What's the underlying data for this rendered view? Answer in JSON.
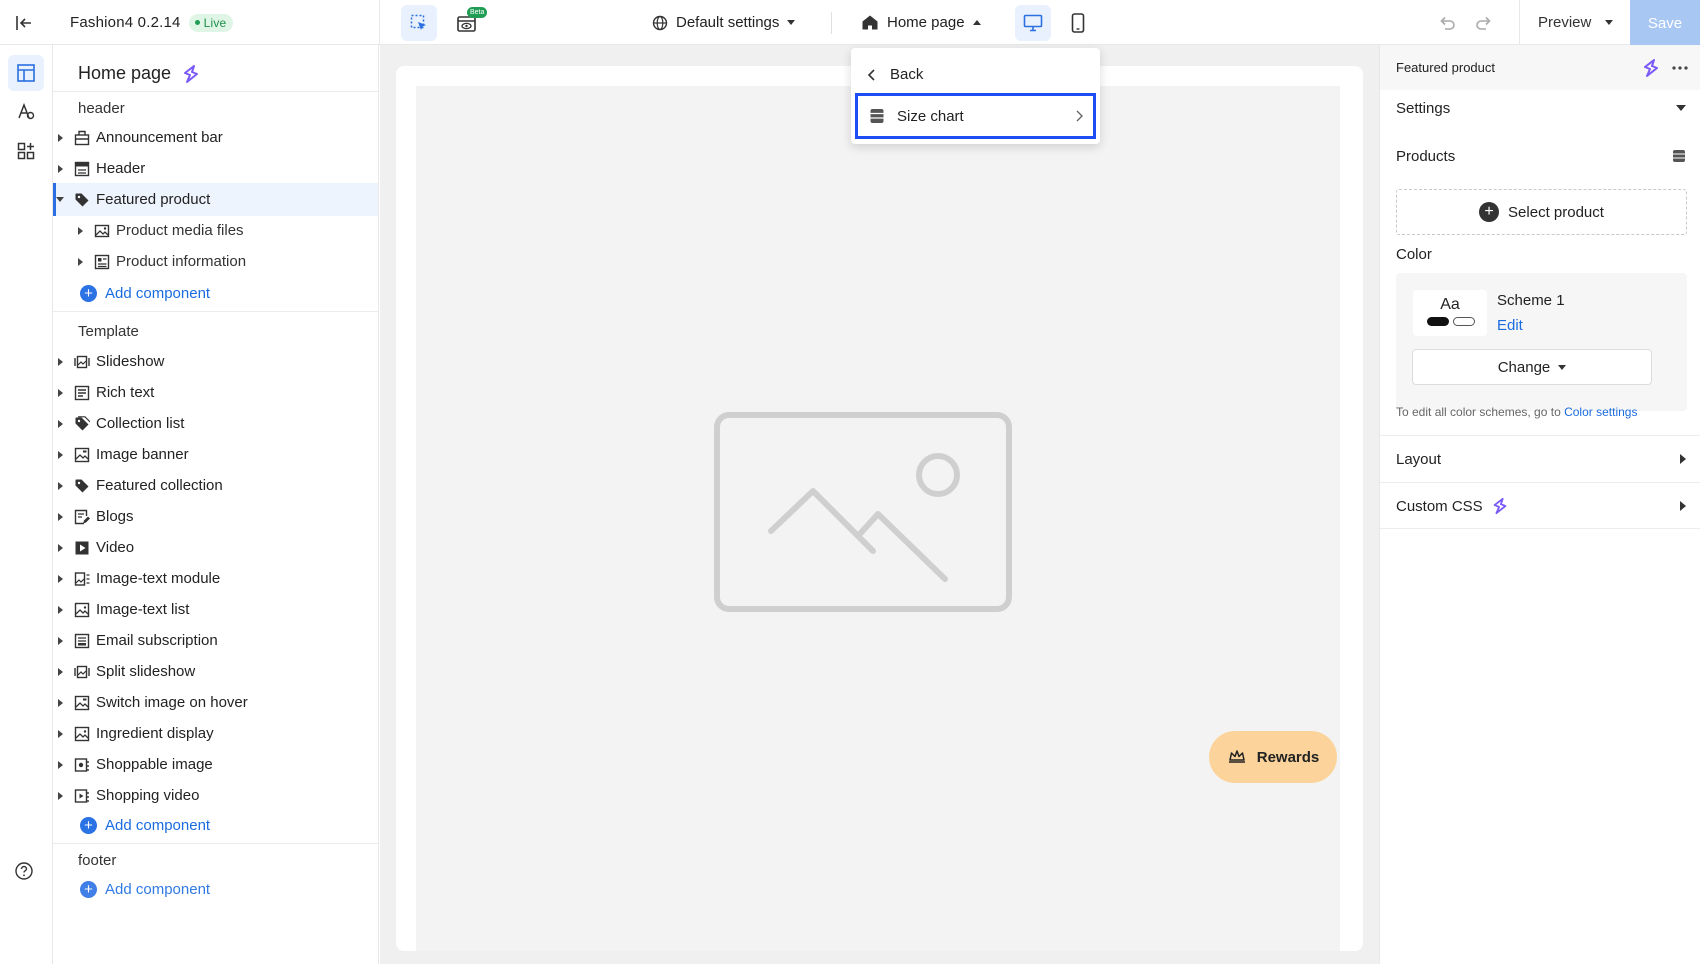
{
  "app": {
    "name_version": "Fashion4 0.2.14",
    "status": "Live"
  },
  "toolbar": {
    "beta_label": "Beta",
    "theme_settings": "Default settings",
    "page_select": "Home page",
    "preview": "Preview",
    "save": "Save"
  },
  "page_menu": {
    "back": "Back",
    "item": "Size chart"
  },
  "sidebar": {
    "title": "Home page",
    "header_group": "header",
    "header_items": [
      {
        "label": "Announcement bar"
      },
      {
        "label": "Header"
      },
      {
        "label": "Featured product"
      },
      {
        "label": "Product media files"
      },
      {
        "label": "Product information"
      }
    ],
    "add_component": "Add component",
    "template_group": "Template",
    "template_items": [
      {
        "label": "Slideshow"
      },
      {
        "label": "Rich text"
      },
      {
        "label": "Collection list"
      },
      {
        "label": "Image banner"
      },
      {
        "label": "Featured collection"
      },
      {
        "label": "Blogs"
      },
      {
        "label": "Video"
      },
      {
        "label": "Image-text module"
      },
      {
        "label": "Image-text list"
      },
      {
        "label": "Email subscription"
      },
      {
        "label": "Split slideshow"
      },
      {
        "label": "Switch image on hover"
      },
      {
        "label": "Ingredient display"
      },
      {
        "label": "Shoppable image"
      },
      {
        "label": "Shopping video"
      }
    ],
    "footer_group": "footer"
  },
  "canvas": {
    "rewards": "Rewards"
  },
  "panel": {
    "title": "Featured product",
    "settings": "Settings",
    "products_label": "Products",
    "select_product": "Select product",
    "color_label": "Color",
    "scheme_sample": "Aa",
    "scheme_name": "Scheme 1",
    "scheme_edit": "Edit",
    "change": "Change",
    "hint_text": "To edit all color schemes, go to",
    "hint_link": "Color settings",
    "layout": "Layout",
    "custom_css": "Custom CSS"
  },
  "colors": {
    "accent": "#2b6fe0",
    "highlight_border": "#1d4ef5",
    "rewards_bg": "#fcd49b",
    "live_green": "#1f8f4a",
    "save_disabled": "#a9c7f3"
  }
}
